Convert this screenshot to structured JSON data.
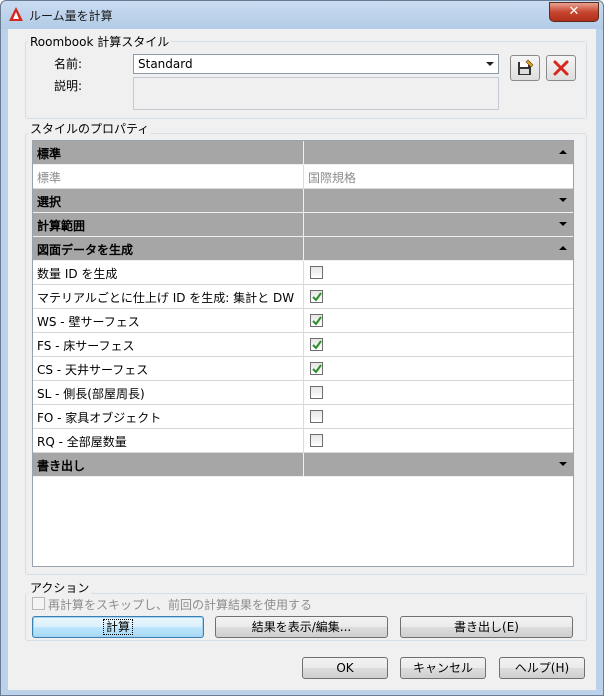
{
  "window": {
    "title": "ルーム量を計算",
    "close_glyph": "✕"
  },
  "style_group": {
    "title": "Roombook 計算スタイル",
    "name_label": "名前:",
    "name_value": "Standard",
    "desc_label": "説明:",
    "desc_value": ""
  },
  "toolbar": {
    "save_icon": "save-style-icon",
    "delete_icon": "delete-red-x-icon"
  },
  "properties": {
    "title": "スタイルのプロパティ",
    "rows": [
      {
        "label": "標準",
        "type": "section",
        "expanded": true
      },
      {
        "label": "標準",
        "type": "value",
        "value": "国際規格",
        "muted": true
      },
      {
        "label": "選択",
        "type": "section",
        "expanded": false
      },
      {
        "label": "計算範囲",
        "type": "section",
        "expanded": false
      },
      {
        "label": "図面データを生成",
        "type": "section",
        "expanded": true
      },
      {
        "label": "数量 ID を生成",
        "type": "check",
        "checked": false
      },
      {
        "label": "マテリアルごとに仕上げ ID を生成: 集計と DW",
        "type": "check",
        "checked": true
      },
      {
        "label": "WS - 壁サーフェス",
        "type": "check",
        "checked": true
      },
      {
        "label": "FS - 床サーフェス",
        "type": "check",
        "checked": true
      },
      {
        "label": "CS - 天井サーフェス",
        "type": "check",
        "checked": true
      },
      {
        "label": "SL - 側長(部屋周長)",
        "type": "check",
        "checked": false
      },
      {
        "label": "FO - 家具オブジェクト",
        "type": "check",
        "checked": false
      },
      {
        "label": "RQ - 全部屋数量",
        "type": "check",
        "checked": false
      },
      {
        "label": "書き出し",
        "type": "section",
        "expanded": false
      }
    ]
  },
  "actions": {
    "title": "アクション",
    "skip_recalc_label": "再計算をスキップし、前回の計算結果を使用する",
    "calc_label": "計算",
    "show_edit_label": "結果を表示/編集...",
    "export_label": "書き出し(E)"
  },
  "footer": {
    "ok_label": "OK",
    "cancel_label": "キャンセル",
    "help_label": "ヘルプ(H)"
  },
  "colors": {
    "section_bg": "#a6a6a6",
    "accent_red": "#d7261e",
    "check_green": "#2a8f2a"
  }
}
